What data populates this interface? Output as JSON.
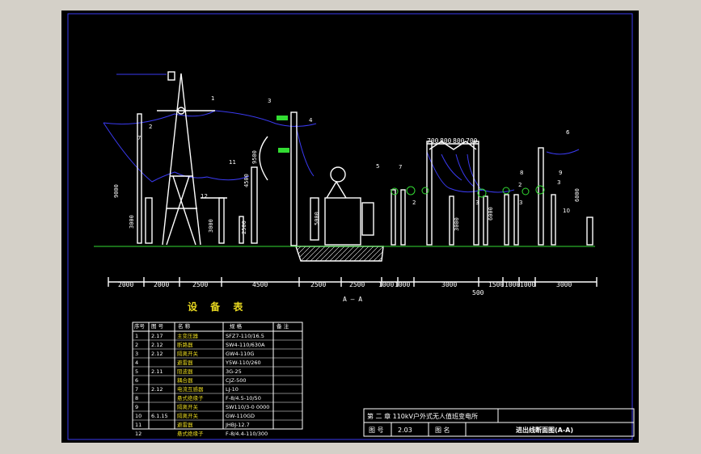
{
  "drawing": {
    "section_label": "A — A",
    "heights": [
      "9000",
      "9500",
      "3000",
      "3000",
      "2500",
      "4500",
      "6000",
      "3000",
      "6000",
      "5000"
    ],
    "top_spacing": [
      "700",
      "800",
      "800",
      "700"
    ],
    "bottom_dims": [
      "2000",
      "2000",
      "2500",
      "4500",
      "2500",
      "2500",
      "1000",
      "1000",
      "3000",
      "1500",
      "1000",
      "1000",
      "3000"
    ],
    "bottom_extra": "500",
    "callouts": [
      "1",
      "2",
      "3",
      "4",
      "5",
      "6",
      "7",
      "8",
      "9",
      "10",
      "11",
      "12",
      "2",
      "3",
      "3",
      "7",
      "2",
      "3"
    ]
  },
  "table": {
    "title": "设 备 表",
    "headers": [
      "序号",
      "图 号",
      "名  称",
      "规   格",
      "备 注"
    ],
    "rows": [
      {
        "no": "1",
        "ref": "2.17",
        "name": "主变压器",
        "spec": "SFZ7-110/16.5"
      },
      {
        "no": "2",
        "ref": "2.12",
        "name": "断路器",
        "spec": "SW4-110/630A"
      },
      {
        "no": "3",
        "ref": "2.12",
        "name": "隔离开关",
        "spec": "GW4-110G"
      },
      {
        "no": "4",
        "ref": "",
        "name": "避雷器",
        "spec": "Y5W-110/260"
      },
      {
        "no": "5",
        "ref": "2.11",
        "name": "阻波器",
        "spec": "3G-25"
      },
      {
        "no": "6",
        "ref": "",
        "name": "耦合器",
        "spec": "CJZ-500"
      },
      {
        "no": "7",
        "ref": "2.12",
        "name": "电流互感器",
        "spec": "LJ-10"
      },
      {
        "no": "8",
        "ref": "",
        "name": "悬式绝缘子",
        "spec": "F-8/4.5-10/50"
      },
      {
        "no": "9",
        "ref": "",
        "name": "隔离开关",
        "spec": "SW110/3-0 0000"
      },
      {
        "no": "10",
        "ref": "6.1.15",
        "name": "隔离开关",
        "spec": "GW-110GD"
      },
      {
        "no": "11",
        "ref": "",
        "name": "避雷器",
        "spec": "JHBJ-12.7"
      },
      {
        "no": "12",
        "ref": "",
        "name": "悬式绝缘子",
        "spec": "F-8/4.4-110/300"
      }
    ]
  },
  "titleblock": {
    "project": "第 二 章  110kV户外式无人值班变电所",
    "fig_no_label": "图  号",
    "fig_no": "2.03",
    "fig_name_label": "图  名",
    "fig_name": "进出线断面图(A-A)"
  }
}
